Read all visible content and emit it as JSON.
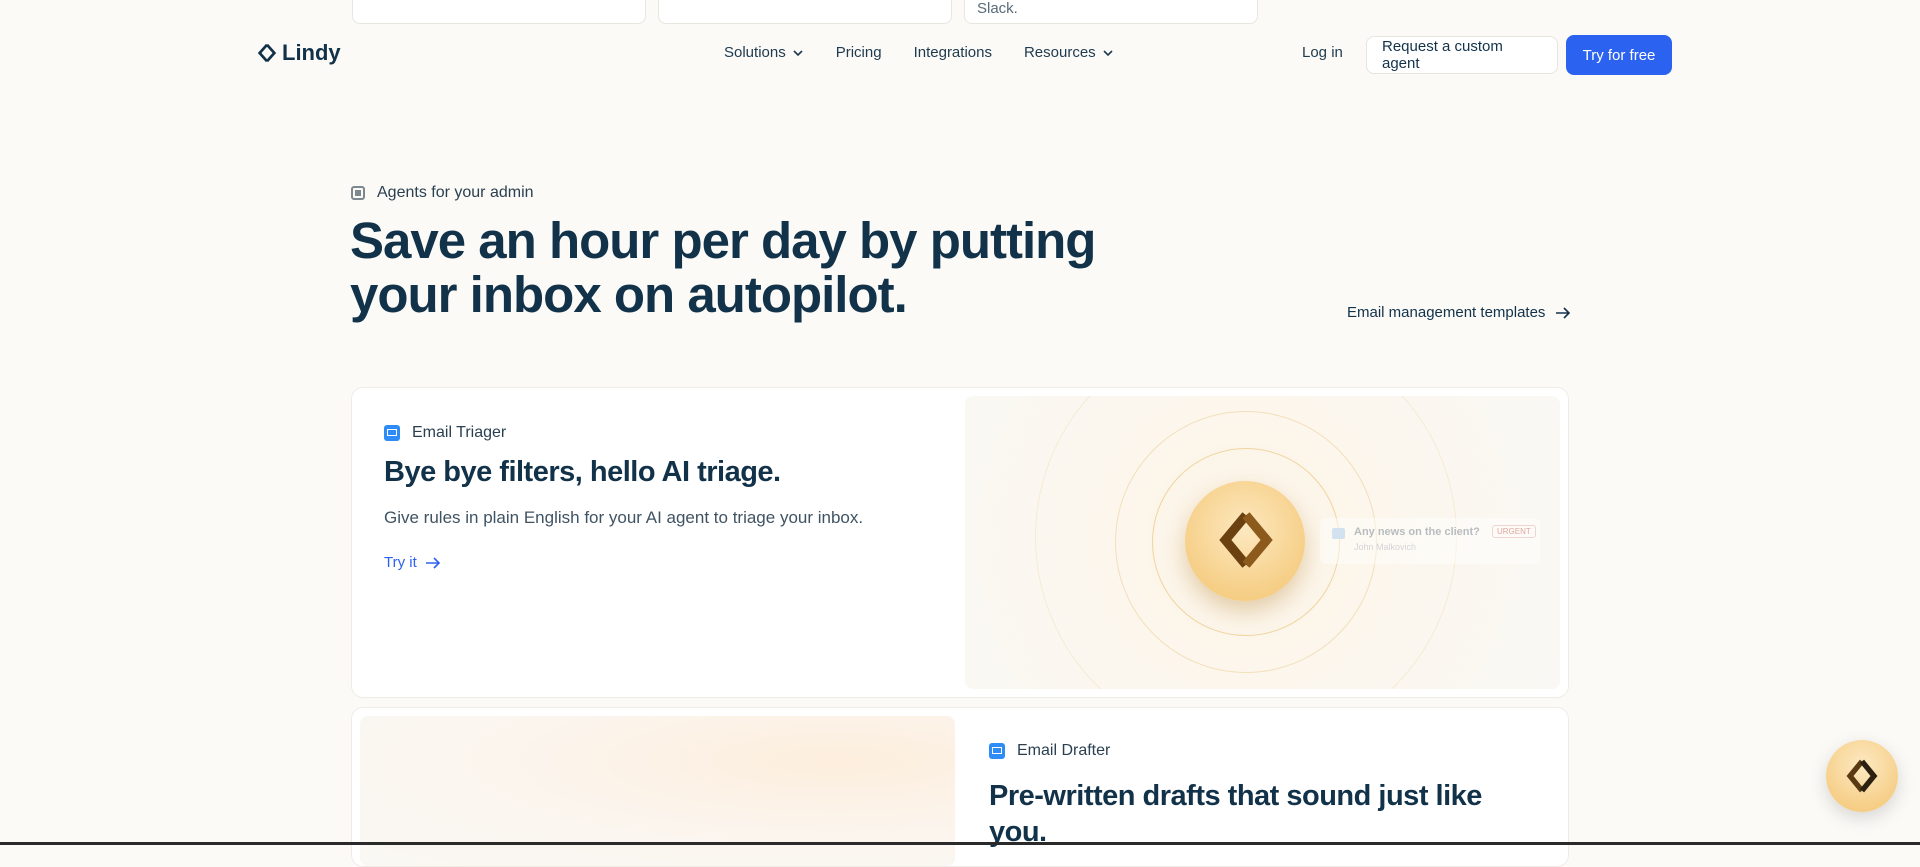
{
  "peek_cards": [
    "",
    "",
    "Slack."
  ],
  "header": {
    "logo_text": "Lindy",
    "nav": [
      {
        "label": "Solutions",
        "dropdown": true
      },
      {
        "label": "Pricing",
        "dropdown": false
      },
      {
        "label": "Integrations",
        "dropdown": false
      },
      {
        "label": "Resources",
        "dropdown": true
      }
    ],
    "login": "Log in",
    "custom_agent": "Request a custom agent",
    "try_free": "Try for free"
  },
  "hero": {
    "eyebrow": "Agents for your admin",
    "title_line1": "Save an hour per day by putting",
    "title_line2": "your inbox on autopilot.",
    "templates_link": "Email management templates"
  },
  "card1": {
    "tag": "Email Triager",
    "title": "Bye bye filters, hello AI triage.",
    "desc": "Give rules in plain English for your AI agent to triage your inbox.",
    "cta": "Try it",
    "notification": {
      "subject": "Any news on the client?",
      "badge": "URGENT",
      "from": "John Malkovich"
    }
  },
  "card2": {
    "tag": "Email Drafter",
    "title_line1": "Pre-written drafts that sound just like",
    "title_line2": "you."
  },
  "colors": {
    "accent": "#2c62f0",
    "text": "#12324a",
    "bg": "#fbfaf7",
    "gold": "#f3c46f"
  }
}
